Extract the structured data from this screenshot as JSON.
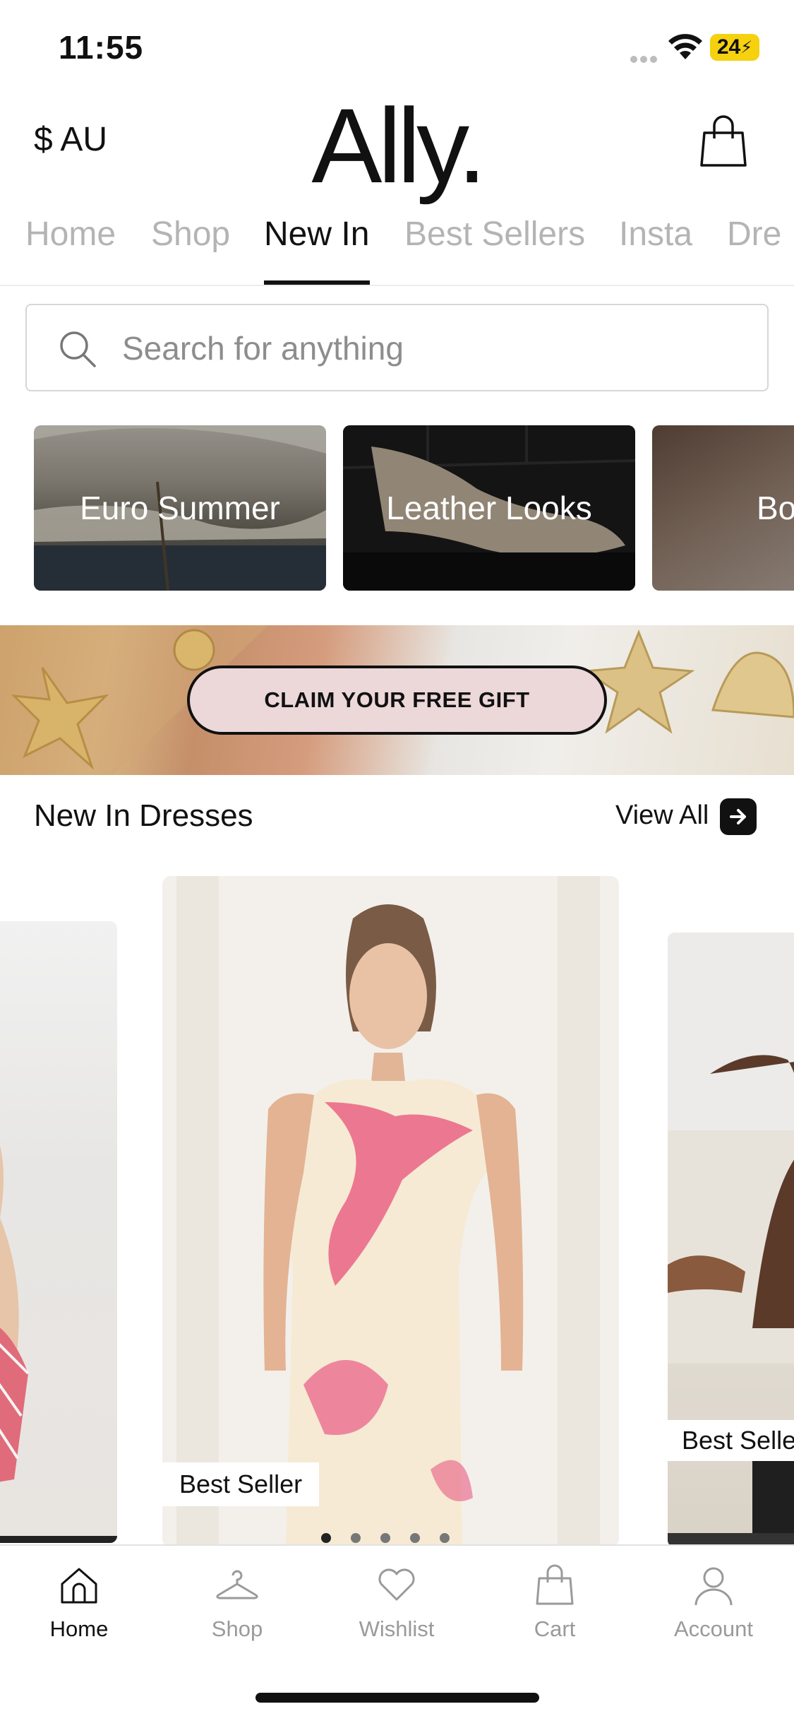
{
  "status_bar": {
    "time": "11:55",
    "battery": "24"
  },
  "header": {
    "currency": "$ AU",
    "logo": "Ally."
  },
  "nav_tabs": [
    {
      "label": "Home",
      "active": false
    },
    {
      "label": "Shop",
      "active": false
    },
    {
      "label": "New In",
      "active": true
    },
    {
      "label": "Best Sellers",
      "active": false
    },
    {
      "label": "Insta",
      "active": false
    },
    {
      "label": "Dre",
      "active": false
    }
  ],
  "search": {
    "placeholder": "Search for anything"
  },
  "collections": [
    {
      "label": "Euro Summer"
    },
    {
      "label": "Leather Looks"
    },
    {
      "label": "Bo"
    }
  ],
  "promo": {
    "button_label": "CLAIM YOUR FREE GIFT"
  },
  "section": {
    "title": "New In Dresses",
    "view_all": "View All"
  },
  "products": [
    {
      "badge": ""
    },
    {
      "badge": "Best Seller"
    },
    {
      "badge": "Best Seller"
    }
  ],
  "carousel": {
    "total_dots": 5,
    "active_dot": 1
  },
  "bottom_nav": [
    {
      "label": "Home",
      "icon": "home-icon",
      "active": true
    },
    {
      "label": "Shop",
      "icon": "hanger-icon",
      "active": false
    },
    {
      "label": "Wishlist",
      "icon": "heart-icon",
      "active": false
    },
    {
      "label": "Cart",
      "icon": "shopping-bag-icon",
      "active": false
    },
    {
      "label": "Account",
      "icon": "user-icon",
      "active": false
    }
  ],
  "colors": {
    "accent": "#111111",
    "inactive": "#b4b4b4",
    "promo_button": "#ecd7d9",
    "battery": "#f5d10f"
  }
}
